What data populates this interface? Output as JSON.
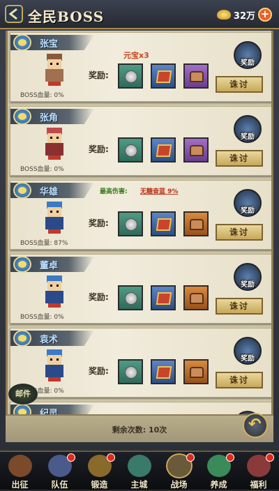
{
  "header": {
    "title": "全民BOSS",
    "gold": "32万"
  },
  "cards": [
    {
      "name": "张宝",
      "hp": "BOSS血量: 0%",
      "top_reward": "元宝x3",
      "items": [
        "teal",
        "blue",
        "purple",
        "purple"
      ]
    },
    {
      "name": "张角",
      "hp": "BOSS血量: 0%",
      "items": [
        "teal",
        "blue",
        "purple",
        "purple"
      ]
    },
    {
      "name": "华雄",
      "hp": "BOSS血量: 87%",
      "top_damage_label": "最高伤害:",
      "top_damage_value": "无糖奋蓝 9%",
      "items": [
        "teal",
        "blue",
        "orange",
        "purple"
      ]
    },
    {
      "name": "董卓",
      "hp": "BOSS血量: 0%",
      "items": [
        "teal",
        "blue",
        "orange",
        "purple"
      ]
    },
    {
      "name": "袁术",
      "hp": "BOSS血量: 0%",
      "items": [
        "teal",
        "blue",
        "orange",
        "purple"
      ]
    },
    {
      "name": "纪灵",
      "hp": "",
      "items": []
    }
  ],
  "labels": {
    "reward": "奖励:",
    "reward_btn": "奖励",
    "fight_btn": "诛讨"
  },
  "remaining": "剩余次数: 10次",
  "mail": "邮件",
  "nav": [
    {
      "label": "出征",
      "dot": false,
      "color": "#7a4a2a"
    },
    {
      "label": "队伍",
      "dot": true,
      "color": "#4a5a8a"
    },
    {
      "label": "锻造",
      "dot": true,
      "color": "#8a6a2a"
    },
    {
      "label": "主城",
      "dot": false,
      "color": "#3a7a6a"
    },
    {
      "label": "战场",
      "dot": true,
      "color": "#6a5a3a",
      "active": true
    },
    {
      "label": "养成",
      "dot": true,
      "color": "#3a8a5a"
    },
    {
      "label": "福利",
      "dot": true,
      "color": "#8a3a3a"
    }
  ]
}
